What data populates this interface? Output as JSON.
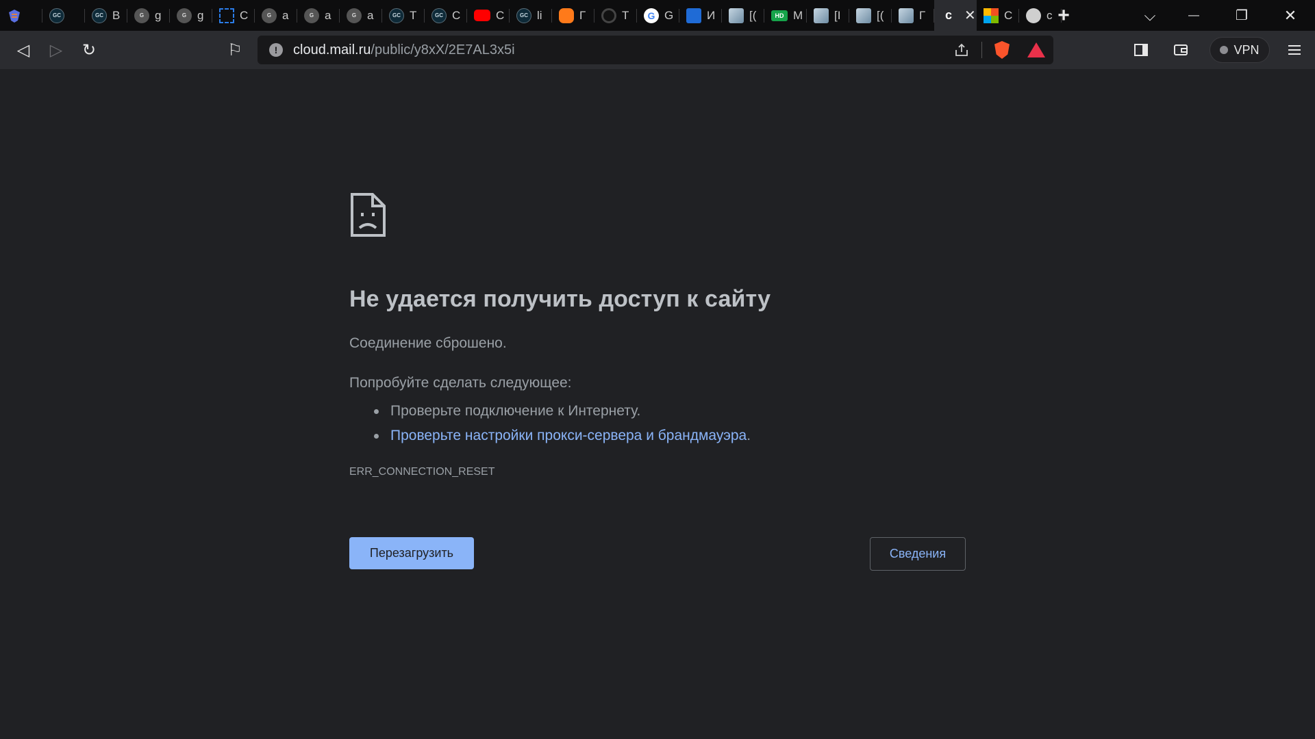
{
  "tabs": [
    {
      "icon": "brave-logo-icon",
      "label": "",
      "fav": "brave"
    },
    {
      "icon": "gc-icon",
      "label": "",
      "fav": "gc"
    },
    {
      "icon": "gc-icon",
      "label": "B",
      "fav": "gc"
    },
    {
      "icon": "gc-icon",
      "label": "g",
      "fav": "gcg"
    },
    {
      "icon": "gc-icon",
      "label": "g",
      "fav": "gcg"
    },
    {
      "icon": "selection-icon",
      "label": "C",
      "fav": "sel"
    },
    {
      "icon": "gc-icon",
      "label": "a",
      "fav": "gcg"
    },
    {
      "icon": "gc-icon",
      "label": "a",
      "fav": "gcg"
    },
    {
      "icon": "gc-icon",
      "label": "a",
      "fav": "gcg"
    },
    {
      "icon": "gc-icon",
      "label": "T",
      "fav": "gc"
    },
    {
      "icon": "gc-icon",
      "label": "C",
      "fav": "gc"
    },
    {
      "icon": "youtube-icon",
      "label": "C",
      "fav": "yt"
    },
    {
      "icon": "gc-icon",
      "label": "li",
      "fav": "gc"
    },
    {
      "icon": "orange-app-icon",
      "label": "Г",
      "fav": "orange"
    },
    {
      "icon": "ring-icon",
      "label": "T",
      "fav": "ring"
    },
    {
      "icon": "google-icon",
      "label": "G",
      "fav": "google"
    },
    {
      "icon": "chart-app-icon",
      "label": "И",
      "fav": "blue"
    },
    {
      "icon": "photo-icon",
      "label": "[(",
      "fav": "photo"
    },
    {
      "icon": "hd-icon",
      "label": "M",
      "fav": "hd"
    },
    {
      "icon": "photo-icon",
      "label": "[I",
      "fav": "photo"
    },
    {
      "icon": "photo-icon",
      "label": "[(",
      "fav": "photo"
    },
    {
      "icon": "photo-icon",
      "label": "Г",
      "fav": "photo"
    },
    {
      "icon": "page-icon",
      "label": "c",
      "fav": "active"
    },
    {
      "icon": "microsoft-icon",
      "label": "C",
      "fav": "ms"
    },
    {
      "icon": "globe-icon",
      "label": "c",
      "fav": "globe"
    }
  ],
  "fav_text": {
    "gc": "GC",
    "gcg": "G",
    "google": "G",
    "hd": "HD",
    "active": "c"
  },
  "tabbar": {
    "new_tab": "+",
    "tab_search": "⌵",
    "minimize": "—",
    "restore": "❐",
    "close": "✕",
    "active_close": "✕"
  },
  "toolbar": {
    "back": "◁",
    "forward": "▷",
    "reload": "↻",
    "bookmark": "⚐",
    "url_host": "cloud.mail.ru",
    "url_path": "/public/y8xX/2E7AL3x5i",
    "vpn_label": "VPN"
  },
  "error_page": {
    "title": "Не удается получить доступ к сайту",
    "subtitle": "Соединение сброшено.",
    "try_label": "Попробуйте сделать следующее:",
    "suggestions": [
      "Проверьте подключение к Интернету.",
      "Проверьте настройки прокси-сервера и брандмауэра"
    ],
    "suggestion_tail": ".",
    "error_code": "ERR_CONNECTION_RESET",
    "reload_button": "Перезагрузить",
    "details_button": "Сведения"
  },
  "colors": {
    "page_bg": "#202124",
    "link": "#8ab4f8",
    "text_secondary": "#9aa0a6",
    "toolbar_bg": "#2b2c30"
  }
}
